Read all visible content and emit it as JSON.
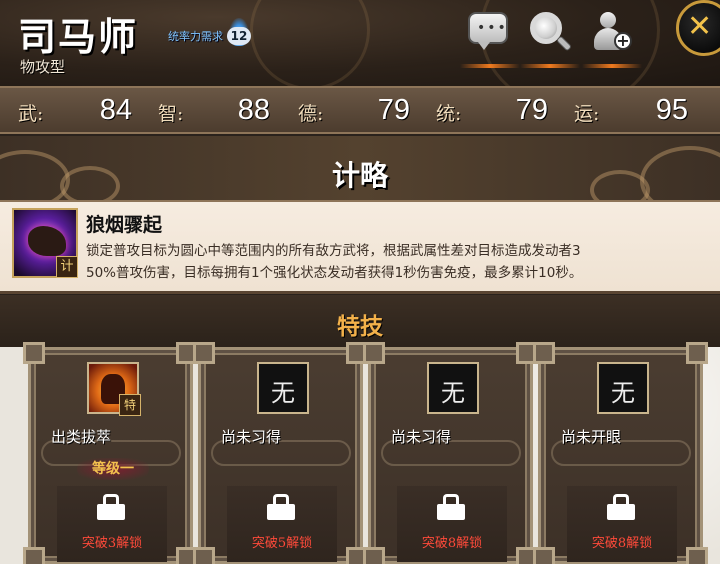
{
  "hero": {
    "name": "司马师",
    "type": "物攻型",
    "command_requirement_label": "统率力需求",
    "command_requirement_value": "12"
  },
  "stats": [
    {
      "label": "武:",
      "value": "84"
    },
    {
      "label": "智:",
      "value": "88"
    },
    {
      "label": "德:",
      "value": "79"
    },
    {
      "label": "统:",
      "value": "79"
    },
    {
      "label": "运:",
      "value": "95"
    }
  ],
  "strategy": {
    "section_title": "计略",
    "name": "狼烟骤起",
    "badge": "计",
    "description_line1": "锁定普攻目标为圆心中等范围内的所有敌方武将，根据武属性差对目标造成发动者3",
    "description_line2": "50%普攻伤害，目标每拥有1个强化状态发动者获得1秒伤害免疫，最多累计10秒。"
  },
  "skills": {
    "section_title": "特技",
    "cards": [
      {
        "name": "出类拔萃",
        "icon_badge": "特",
        "level": "等级一",
        "unlock": "突破3解锁"
      },
      {
        "name": "尚未习得",
        "icon_glyph": "无",
        "unlock": "突破5解锁"
      },
      {
        "name": "尚未习得",
        "icon_glyph": "无",
        "unlock": "突破8解锁"
      },
      {
        "name": "尚未开眼",
        "icon_glyph": "无",
        "unlock": "突破8解锁"
      }
    ]
  },
  "icons": {
    "chat": "chat-bubble-icon",
    "search": "magnifier-icon",
    "add_friend": "add-friend-icon",
    "close": "close-icon"
  },
  "colors": {
    "accent_gold": "#f3b14a",
    "unlock_red": "#ff4a3a",
    "requirement_blue": "#7ec3ff"
  }
}
